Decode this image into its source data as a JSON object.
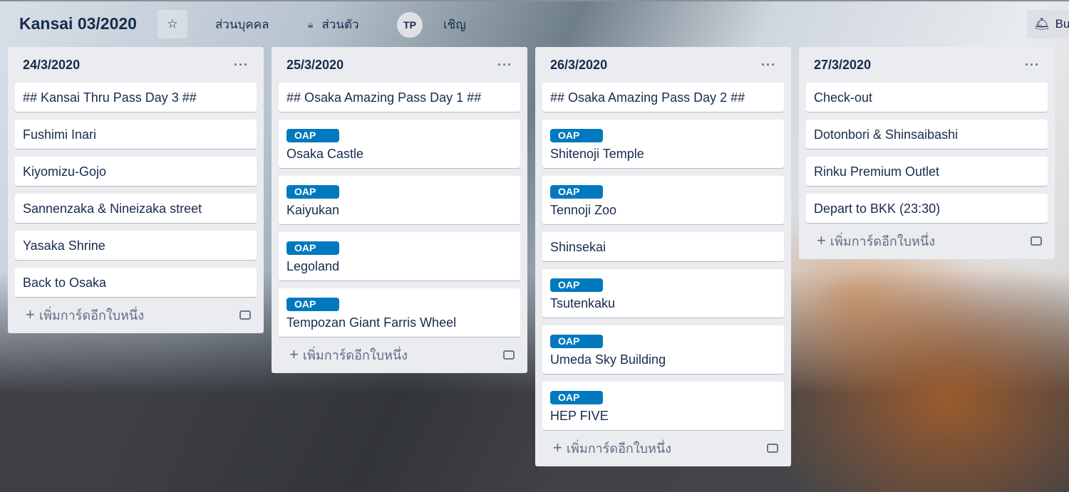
{
  "board": {
    "title": "Kansai 03/2020",
    "visibility_team": "ส่วนบุคคล",
    "visibility_private": "ส่วนตัว",
    "member_initials": "TP",
    "invite": "เชิญ",
    "butler": "Bu"
  },
  "add_card_label": "เพิ่มการ์ดอีกใบหนึ่ง",
  "more_label": "···",
  "label_color": "#0079bf",
  "lists": [
    {
      "title": "24/3/2020",
      "cards": [
        {
          "title": "## Kansai Thru Pass Day 3 ##"
        },
        {
          "title": "Fushimi Inari"
        },
        {
          "title": "Kiyomizu-Gojo"
        },
        {
          "title": "Sannenzaka & Nineizaka street"
        },
        {
          "title": "Yasaka Shrine"
        },
        {
          "title": "Back to Osaka"
        }
      ]
    },
    {
      "title": "25/3/2020",
      "cards": [
        {
          "title": "## Osaka Amazing Pass Day 1 ##"
        },
        {
          "label": "OAP",
          "title": "Osaka Castle"
        },
        {
          "label": "OAP",
          "title": "Kaiyukan"
        },
        {
          "label": "OAP",
          "title": "Legoland"
        },
        {
          "label": "OAP",
          "title": "Tempozan Giant Farris Wheel"
        }
      ]
    },
    {
      "title": "26/3/2020",
      "cards": [
        {
          "title": "## Osaka Amazing Pass Day 2 ##"
        },
        {
          "label": "OAP",
          "title": "Shitenoji Temple"
        },
        {
          "label": "OAP",
          "title": "Tennoji Zoo"
        },
        {
          "title": "Shinsekai"
        },
        {
          "label": "OAP",
          "title": "Tsutenkaku"
        },
        {
          "label": "OAP",
          "title": "Umeda Sky Building"
        },
        {
          "label": "OAP",
          "title": "HEP FIVE"
        }
      ]
    },
    {
      "title": "27/3/2020",
      "cards": [
        {
          "title": "Check-out"
        },
        {
          "title": "Dotonbori & Shinsaibashi"
        },
        {
          "title": "Rinku Premium Outlet"
        },
        {
          "title": "Depart to BKK (23:30)"
        }
      ]
    }
  ]
}
